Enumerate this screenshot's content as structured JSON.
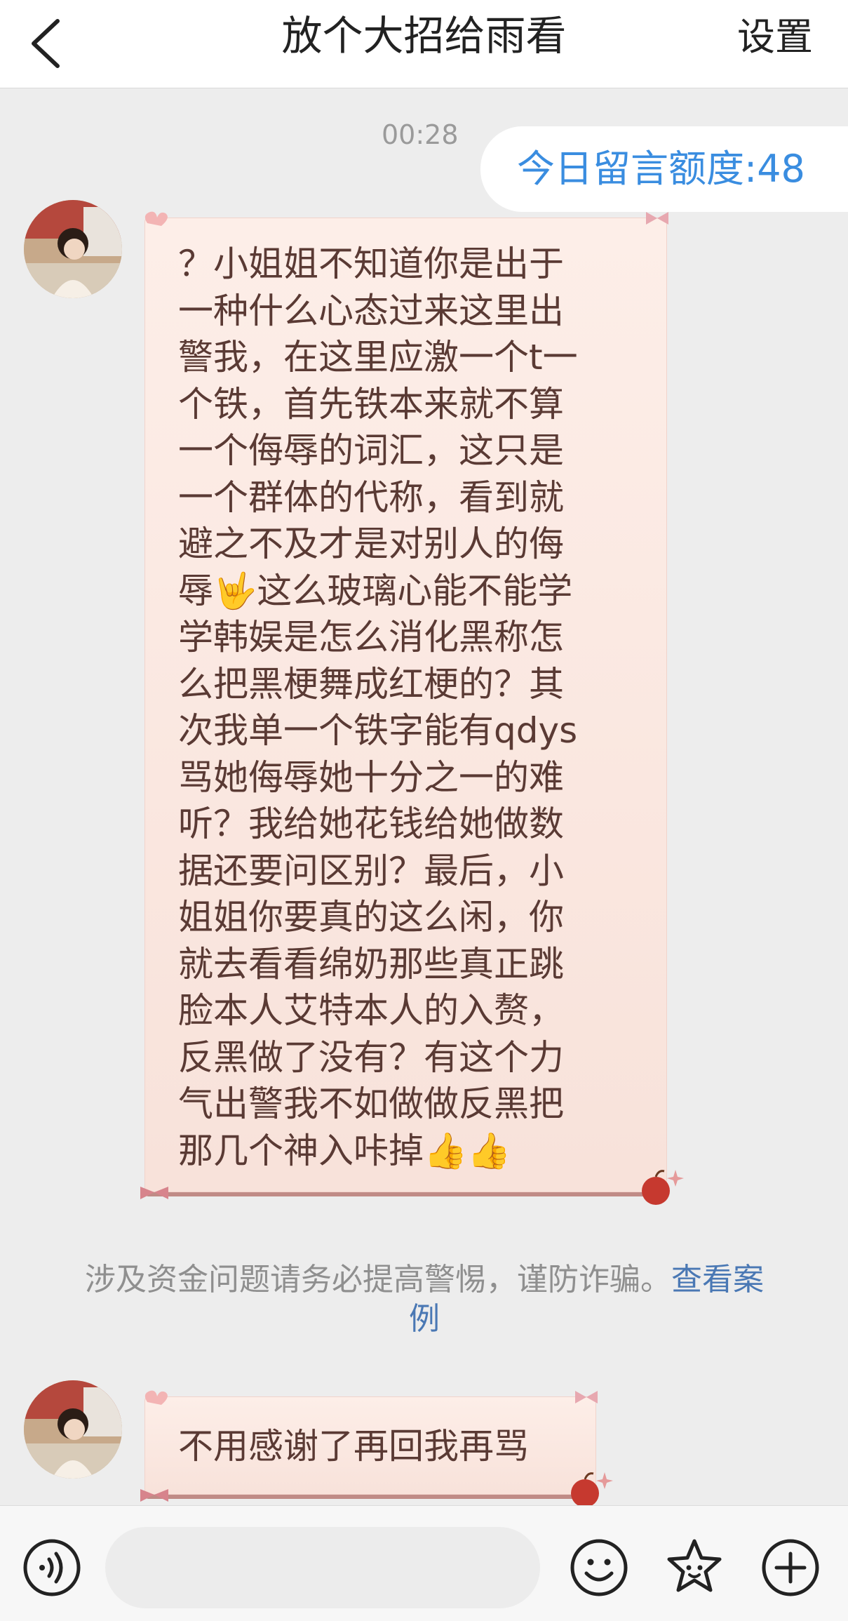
{
  "header": {
    "title": "放个大招给雨看",
    "settings_label": "设置"
  },
  "chat": {
    "time": "00:28",
    "quota": "今日留言额度:48",
    "message1_lines": [
      "？小姐姐不知道你是出于",
      "一种什么心态过来这里出",
      "警我，在这里应激一个t一",
      "个铁，首先铁本来就不算",
      "一个侮辱的词汇，这只是",
      "一个群体的代称，看到就",
      "避之不及才是对别人的侮",
      "辱🤟这么玻璃心能不能学",
      "学韩娱是怎么消化黑称怎",
      "么把黑梗舞成红梗的？其",
      "次我单一个铁字能有qdys",
      "骂她侮辱她十分之一的难",
      "听？我给她花钱给她做数",
      "据还要问区别？最后，小",
      "姐姐你要真的这么闲，你",
      "就去看看绵奶那些真正跳",
      "脸本人艾特本人的入赘，",
      "反黑做了没有？有这个力",
      "气出警我不如做做反黑把",
      "那几个神入咔掉👍👍"
    ],
    "notice_text": "涉及资金问题请务必提高警惕，谨防诈骗。",
    "notice_link": "查看案例",
    "message2": "不用感谢了再回我再骂"
  },
  "input": {
    "placeholder": ""
  },
  "colors": {
    "accent": "#3a8de0",
    "bubble_text": "#5a3a34",
    "link": "#4a78b4"
  },
  "icons": [
    "back-icon",
    "voice-icon",
    "emoji-icon",
    "sticker-icon",
    "plus-icon"
  ]
}
